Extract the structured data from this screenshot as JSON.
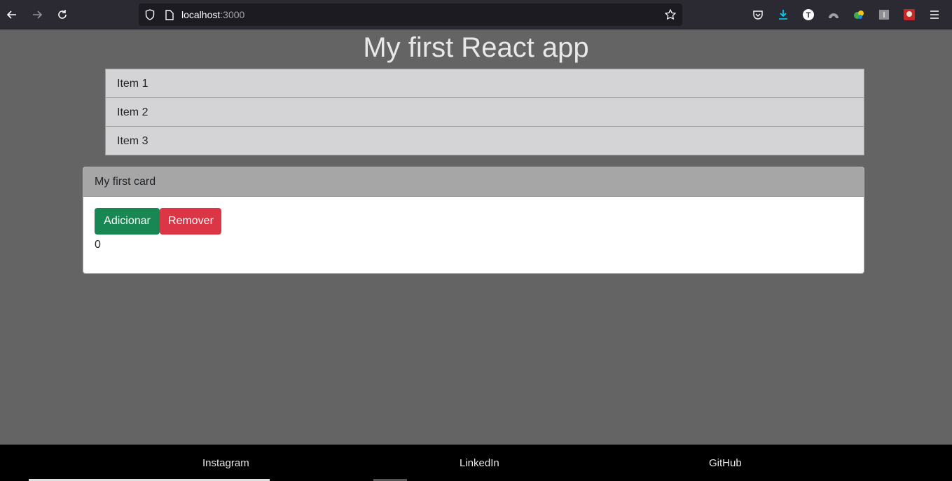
{
  "browser": {
    "url_host": "localhost",
    "url_port": ":3000",
    "icons": {
      "back": "arrow-left-icon",
      "forward": "arrow-right-icon",
      "reload": "reload-icon",
      "shield": "shield-icon",
      "page": "page-icon",
      "bookmark": "star-icon",
      "pocket": "pocket-icon",
      "download": "download-icon",
      "ext_t": "extension-t-icon",
      "ext_arc": "extension-arc-icon",
      "ext_color": "extension-color-icon",
      "ext_gray": "extension-gray-icon",
      "ext_red": "extension-red-icon",
      "menu": "hamburger-menu-icon"
    },
    "colors": {
      "toolbar": "#2b2a33",
      "urlbar": "#1c1b22",
      "download_accent": "#00ddff"
    }
  },
  "app": {
    "title": "My first React app",
    "list": [
      "Item 1",
      "Item 2",
      "Item 3"
    ],
    "card": {
      "header": "My first card",
      "add_label": "Adicionar",
      "remove_label": "Remover",
      "counter": "0"
    },
    "colors": {
      "background": "#646464",
      "add": "#198754",
      "remove": "#dc3545"
    }
  },
  "footer": {
    "links": [
      "Instagram",
      "LinkedIn",
      "GitHub"
    ]
  }
}
